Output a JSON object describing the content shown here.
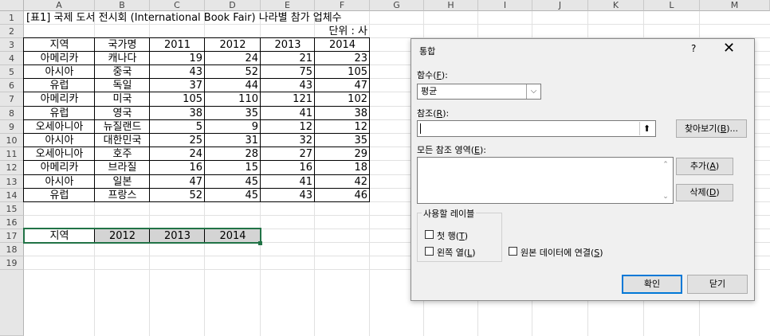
{
  "spreadsheet": {
    "columns": [
      "A",
      "B",
      "C",
      "D",
      "E",
      "F",
      "G",
      "H",
      "I",
      "J",
      "K",
      "L",
      "M"
    ],
    "rows": [
      "1",
      "2",
      "3",
      "4",
      "5",
      "6",
      "7",
      "8",
      "9",
      "10",
      "11",
      "12",
      "13",
      "14",
      "15",
      "16",
      "17",
      "18",
      "19"
    ],
    "title": "[표1] 국제 도서 전시회 (International Book Fair) 나라별 참가 업체수",
    "unit_note": "단위 : 사",
    "table_headers": [
      "지역",
      "국가명",
      "2011",
      "2012",
      "2013",
      "2014"
    ],
    "table_rows": [
      [
        "아메리카",
        "캐나다",
        "19",
        "24",
        "21",
        "23"
      ],
      [
        "아시아",
        "중국",
        "43",
        "52",
        "75",
        "105"
      ],
      [
        "유럽",
        "독일",
        "37",
        "44",
        "43",
        "47"
      ],
      [
        "아메리카",
        "미국",
        "105",
        "110",
        "121",
        "102"
      ],
      [
        "유럽",
        "영국",
        "38",
        "35",
        "41",
        "38"
      ],
      [
        "오세아니아",
        "뉴질랜드",
        "5",
        "9",
        "12",
        "12"
      ],
      [
        "아시아",
        "대한민국",
        "25",
        "31",
        "32",
        "35"
      ],
      [
        "오세아니아",
        "호주",
        "24",
        "28",
        "27",
        "29"
      ],
      [
        "아메리카",
        "브라질",
        "16",
        "15",
        "16",
        "18"
      ],
      [
        "아시아",
        "일본",
        "47",
        "45",
        "41",
        "42"
      ],
      [
        "유럽",
        "프랑스",
        "52",
        "45",
        "43",
        "46"
      ]
    ],
    "consolidate_headers": [
      "지역",
      "2012",
      "2013",
      "2014"
    ]
  },
  "dialog": {
    "title": "통합",
    "help": "?",
    "close": "✕",
    "function_label": "함수",
    "function_key": "F",
    "function_value": "평균",
    "reference_label": "참조",
    "reference_key": "R",
    "reference_value": "",
    "collapse_icon": "⬆",
    "browse_label": "찾아보기(",
    "browse_key": "B",
    "browse_tail": ")...",
    "all_refs_label": "모든 참조 영역",
    "all_refs_key": "E",
    "add_label": "추가(",
    "add_key": "A",
    "delete_label": "삭제(",
    "delete_key": "D",
    "labels_group": "사용할 레이블",
    "top_row_label": "첫 행",
    "top_row_key": "T",
    "left_col_label": "왼쪽 열",
    "left_col_key": "L",
    "link_label": "원본 데이터에 연결",
    "link_key": "S",
    "ok_label": "확인",
    "close_label": "닫기",
    "top_row_checked": false,
    "left_col_checked": false,
    "link_checked": false
  }
}
